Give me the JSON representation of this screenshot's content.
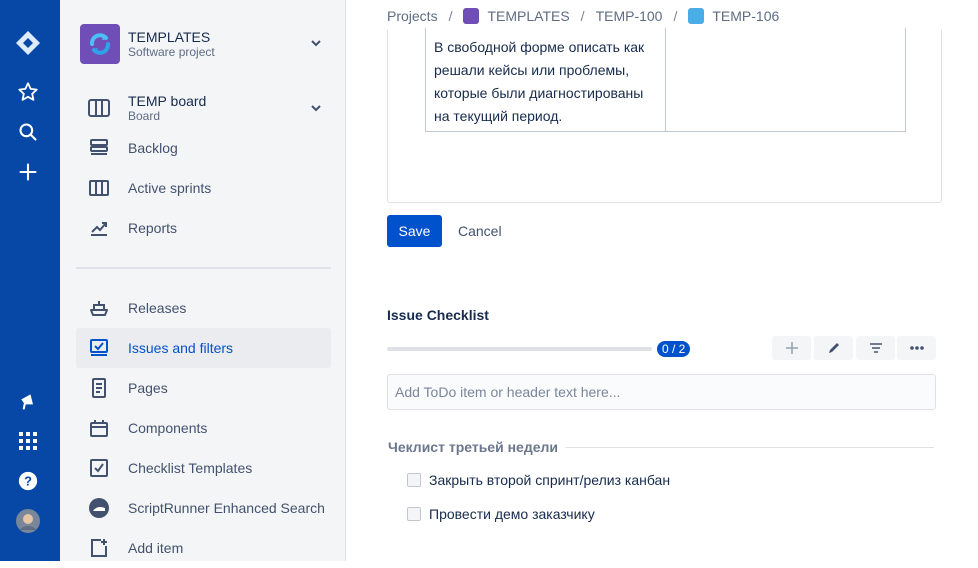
{
  "global_nav": {
    "icons": [
      "jira-logo-icon",
      "star-icon",
      "search-icon",
      "plus-icon",
      "megaphone-icon",
      "app-switcher-icon",
      "help-icon",
      "user-avatar"
    ]
  },
  "sidebar": {
    "project_name": "TEMPLATES",
    "project_type": "Software project",
    "board_name": "TEMP board",
    "board_type": "Board",
    "items": [
      {
        "label": "Backlog",
        "icon": "backlog-icon"
      },
      {
        "label": "Active sprints",
        "icon": "sprints-icon"
      },
      {
        "label": "Reports",
        "icon": "reports-icon"
      }
    ],
    "items2": [
      {
        "label": "Releases",
        "icon": "ship-icon"
      },
      {
        "label": "Issues and filters",
        "icon": "issues-icon",
        "active": true
      },
      {
        "label": "Pages",
        "icon": "page-icon"
      },
      {
        "label": "Components",
        "icon": "component-icon"
      },
      {
        "label": "Checklist Templates",
        "icon": "checklist-icon"
      },
      {
        "label": "ScriptRunner Enhanced Search",
        "icon": "scriptrunner-icon"
      },
      {
        "label": "Add item",
        "icon": "add-item-icon"
      }
    ]
  },
  "breadcrumbs": {
    "projects": "Projects",
    "project": "TEMPLATES",
    "parent": "TEMP-100",
    "issue": "TEMP-106",
    "separator": "/"
  },
  "editor": {
    "cell_text": "В свободной форме описать как решали кейсы или проблемы, которые были диагностированы на текущий период."
  },
  "actions": {
    "save": "Save",
    "cancel": "Cancel"
  },
  "checklist": {
    "title": "Issue Checklist",
    "progress_label": "0 / 2",
    "progress_fraction": 0,
    "input_placeholder": "Add ToDo item or header text here...",
    "header": "Чеклист третьей недели",
    "items": [
      {
        "text": "Закрыть второй спринт/релиз канбан",
        "checked": false
      },
      {
        "text": "Провести демо заказчику",
        "checked": false
      }
    ]
  },
  "colors": {
    "global_nav": "#0747a6",
    "primary": "#0052cc",
    "project_avatar": "#6f4fb7"
  }
}
